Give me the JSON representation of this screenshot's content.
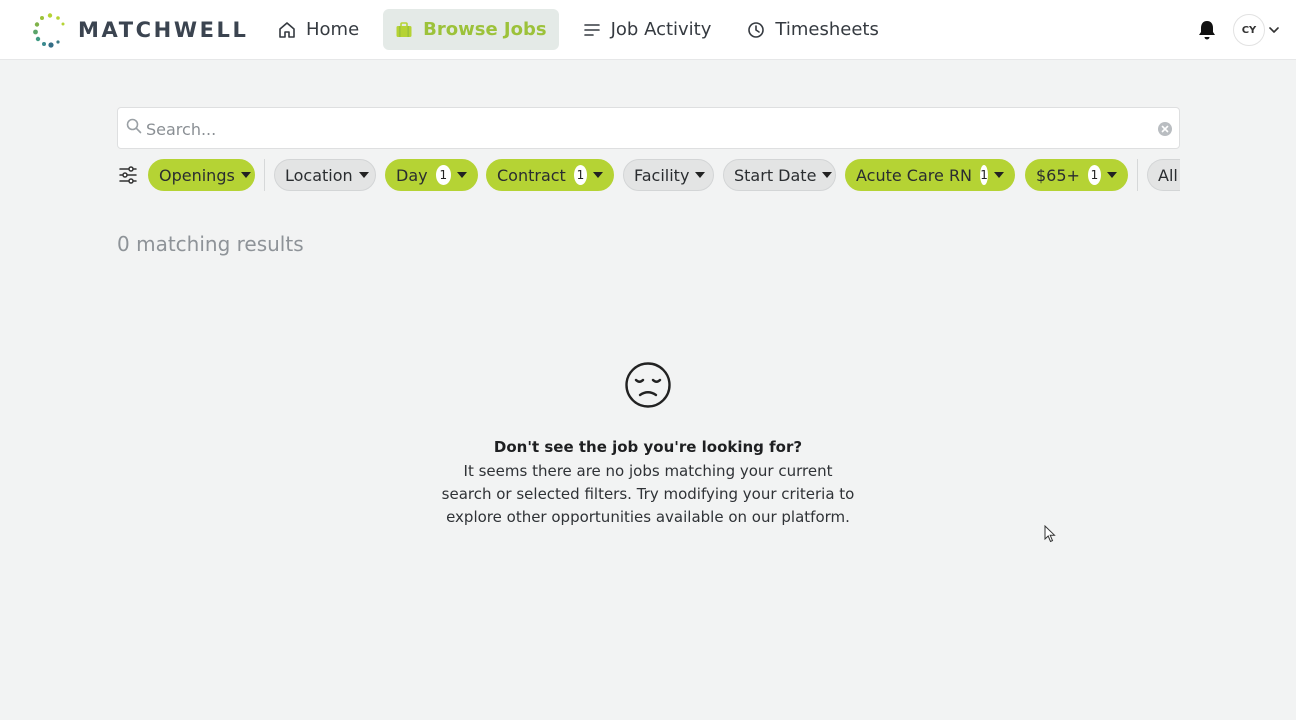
{
  "brand": {
    "name": "MATCHWELL",
    "accent": "#b5d334",
    "dark": "#3b4450"
  },
  "nav": {
    "items": [
      {
        "label": "Home",
        "icon": "home-icon",
        "active": false
      },
      {
        "label": "Browse Jobs",
        "icon": "briefcase-icon",
        "active": true
      },
      {
        "label": "Job Activity",
        "icon": "list-icon",
        "active": false
      },
      {
        "label": "Timesheets",
        "icon": "clock-icon",
        "active": false
      }
    ]
  },
  "header": {
    "avatar_initials": "CY",
    "bell_icon": "bell-icon",
    "avatar_chevron": "chevron-down-icon"
  },
  "search": {
    "placeholder": "Search...",
    "value": ""
  },
  "filters": [
    {
      "label": "Openings",
      "active": true,
      "count": null
    },
    {
      "label": "Location",
      "active": false,
      "count": null
    },
    {
      "label": "Day",
      "active": true,
      "count": "1"
    },
    {
      "label": "Contract",
      "active": true,
      "count": "1"
    },
    {
      "label": "Facility",
      "active": false,
      "count": null
    },
    {
      "label": "Start Date",
      "active": false,
      "count": null
    },
    {
      "label": "Acute Care RN",
      "active": true,
      "count": "1"
    },
    {
      "label": "$65+",
      "active": true,
      "count": "1"
    },
    {
      "label": "All",
      "active": false,
      "count": null
    }
  ],
  "results": {
    "summary": "0 matching results"
  },
  "empty_state": {
    "icon": "sad-face-icon",
    "title": "Don't see the job you're looking for?",
    "body": "It seems there are no jobs matching your current search or selected filters. Try modifying your criteria to explore other opportunities available on our platform."
  }
}
